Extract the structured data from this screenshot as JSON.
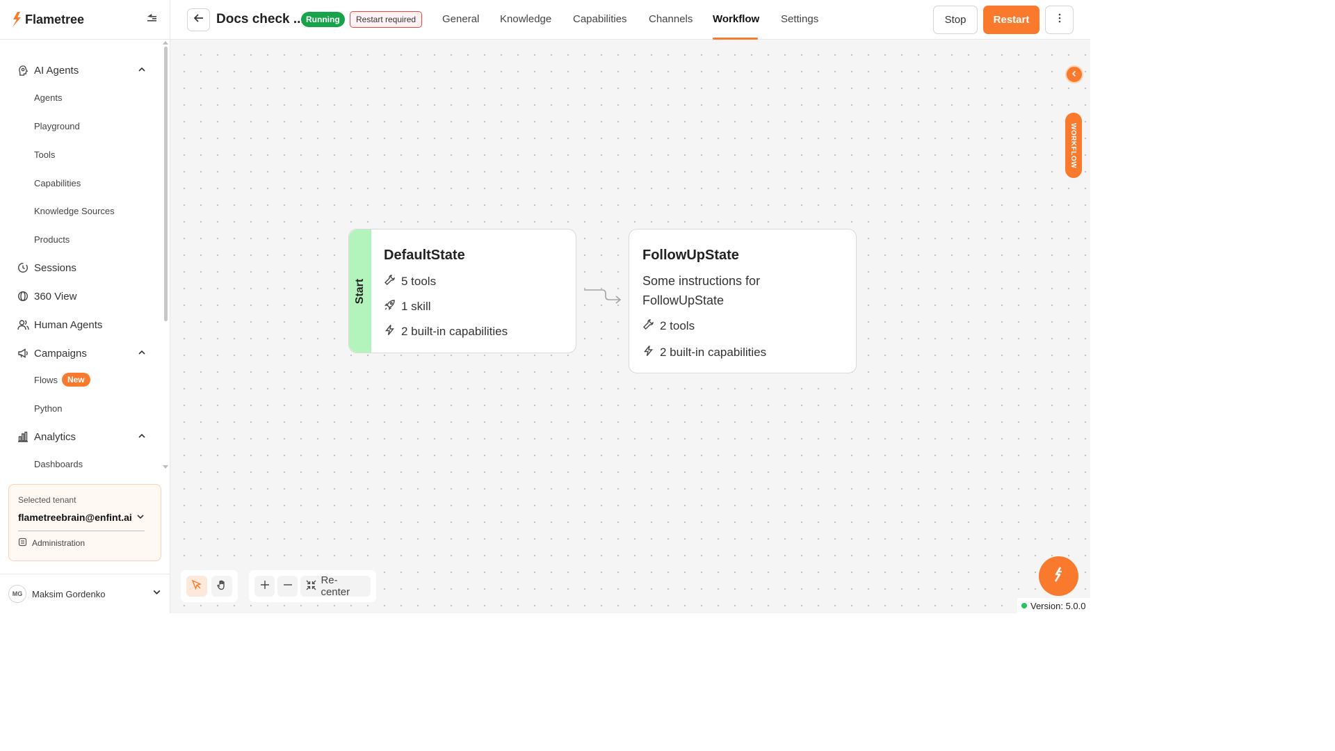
{
  "brand": {
    "name": "Flametree"
  },
  "sidebar": {
    "sections": [
      {
        "label": "AI Agents",
        "icon": "brain-icon",
        "expanded": true,
        "items": [
          "Agents",
          "Playground",
          "Tools",
          "Capabilities",
          "Knowledge Sources",
          "Products"
        ]
      },
      {
        "label": "Sessions",
        "icon": "history-icon"
      },
      {
        "label": "360 View",
        "icon": "view-360-icon"
      },
      {
        "label": "Human Agents",
        "icon": "users-icon"
      },
      {
        "label": "Campaigns",
        "icon": "megaphone-icon",
        "expanded": true,
        "items": [
          "Flows",
          "Python"
        ],
        "flows_badge": "New"
      },
      {
        "label": "Analytics",
        "icon": "bar-chart-icon",
        "expanded": true,
        "items": [
          "Dashboards"
        ]
      }
    ]
  },
  "tenant": {
    "label": "Selected tenant",
    "value": "flametreebrain@enfint.ai",
    "admin_label": "Administration"
  },
  "user": {
    "initials": "MG",
    "name": "Maksim Gordenko"
  },
  "header": {
    "title": "Docs check ...",
    "status_badge": "Running",
    "restart_badge": "Restart required",
    "tabs": [
      "General",
      "Knowledge",
      "Capabilities",
      "Channels",
      "Workflow",
      "Settings"
    ],
    "active_tab": "Workflow",
    "stop_label": "Stop",
    "restart_label": "Restart"
  },
  "workflow": {
    "side_tab_label": "WORKFLOW",
    "nodes": [
      {
        "start_label": "Start",
        "title": "DefaultState",
        "tools": "5 tools",
        "skills": "1 skill",
        "capabilities": "2 built-in capabilities"
      },
      {
        "title": "FollowUpState",
        "description": "Some instructions for FollowUpState",
        "tools": "2 tools",
        "capabilities": "2 built-in capabilities"
      }
    ],
    "recenter_label": "Re-center"
  },
  "version": "Version: 5.0.0",
  "colors": {
    "accent": "#f97a2d",
    "running": "#16a34a",
    "start_band": "#b3f4bd"
  }
}
